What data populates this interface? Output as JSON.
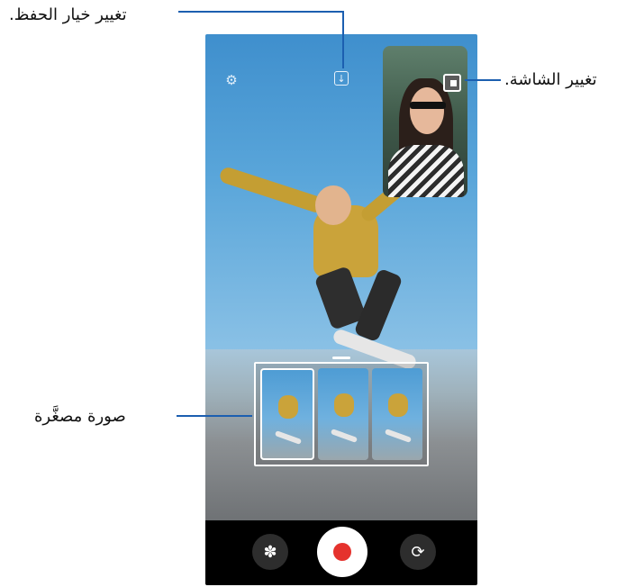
{
  "callouts": {
    "change_save_option": "تغيير خيار الحفظ.",
    "change_screen": "تغيير الشاشة.",
    "thumbnail": "صورة مصغَّرة"
  },
  "icons": {
    "settings": "gear-icon",
    "save_option": "save-down-arrow-icon",
    "change_screen": "screen-swap-icon",
    "bokeh": "flower-effect-icon",
    "record": "record-icon",
    "switch_camera": "switch-camera-icon"
  },
  "colors": {
    "callout_line": "#1c5fb0",
    "record_dot": "#e5322d"
  }
}
